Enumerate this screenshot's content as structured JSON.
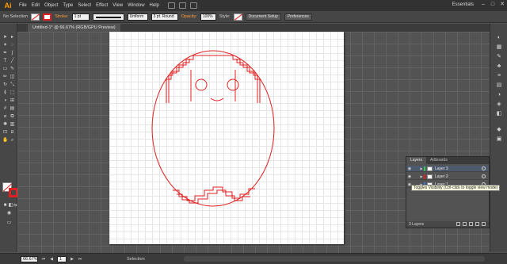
{
  "app": {
    "logo": "Ai",
    "workspace": "Essentials"
  },
  "menu": [
    "File",
    "Edit",
    "Object",
    "Type",
    "Select",
    "Effect",
    "View",
    "Window",
    "Help"
  ],
  "control_bar": {
    "selection": "No Selection",
    "stroke_label": "Stroke:",
    "stroke_weight": "1 pt",
    "profile": "Uniform",
    "brush": "3 pt. Round",
    "opacity_label": "Opacity:",
    "opacity_value": "100%",
    "style_label": "Style:",
    "doc_setup": "Document Setup",
    "preferences": "Preferences"
  },
  "document": {
    "tab_title": "Untitled-1* @ 66.67% (RGB/GPU Preview)"
  },
  "layers_panel": {
    "tabs": [
      "Layers",
      "Artboards"
    ],
    "rows": [
      {
        "name": "Layer 3",
        "color": "#35c93a",
        "selected": true
      },
      {
        "name": "Layer 2",
        "color": "#e02020",
        "selected": false
      },
      {
        "name": "Layer 1",
        "color": "#3a74e8",
        "selected": false
      }
    ],
    "tooltip": "Toggles Visibility (Ctrl-click to toggle view mode)",
    "count": "3 Layers"
  },
  "status": {
    "zoom": "66.67%",
    "page": "1",
    "tool": "Selection"
  },
  "colors": {
    "stroke": "#e02020",
    "accent": "#ff9a00"
  }
}
